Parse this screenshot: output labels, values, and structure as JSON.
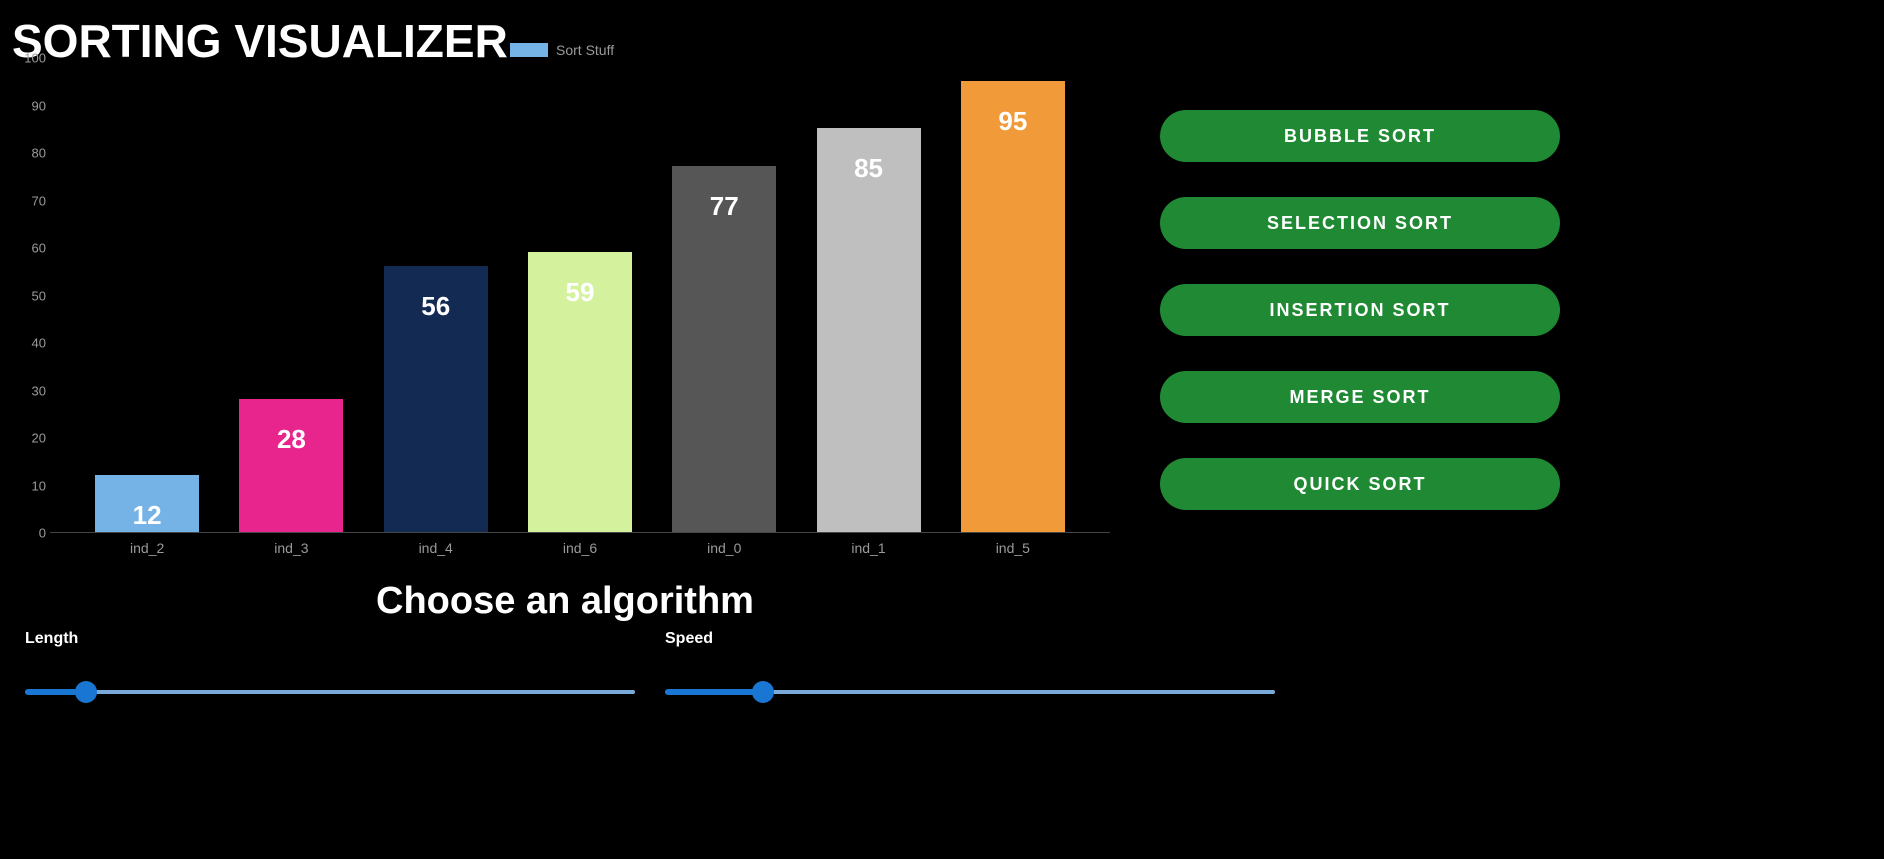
{
  "title": "SORTING VISUALIZER",
  "legend_label": "Sort Stuff",
  "status_text": "Choose an algorithm",
  "buttons": [
    "BUBBLE SORT",
    "SELECTION SORT",
    "INSERTION SORT",
    "MERGE SORT",
    "QUICK SORT"
  ],
  "sliders": {
    "length": {
      "label": "Length",
      "value_pct": 10
    },
    "speed": {
      "label": "Speed",
      "value_pct": 16
    }
  },
  "colors": {
    "bar_palette": [
      "#75b3e7",
      "#e8258d",
      "#132b53",
      "#d4f29e",
      "#565656",
      "#bfbfbf",
      "#f09a39"
    ],
    "button_bg": "#1f8a33",
    "slider_fill": "#1976d2",
    "slider_track": "#7aa8d8"
  },
  "chart_data": {
    "type": "bar",
    "categories": [
      "ind_2",
      "ind_3",
      "ind_4",
      "ind_6",
      "ind_0",
      "ind_1",
      "ind_5"
    ],
    "values": [
      12,
      28,
      56,
      59,
      77,
      85,
      95
    ],
    "series_name": "Sort Stuff",
    "ylim": [
      0,
      100
    ],
    "yticks": [
      0,
      10,
      20,
      30,
      40,
      50,
      60,
      70,
      80,
      90,
      100
    ],
    "bar_colors": [
      "#75b3e7",
      "#e8258d",
      "#132b53",
      "#d4f29e",
      "#565656",
      "#bfbfbf",
      "#f09a39"
    ],
    "title": "",
    "xlabel": "",
    "ylabel": ""
  }
}
